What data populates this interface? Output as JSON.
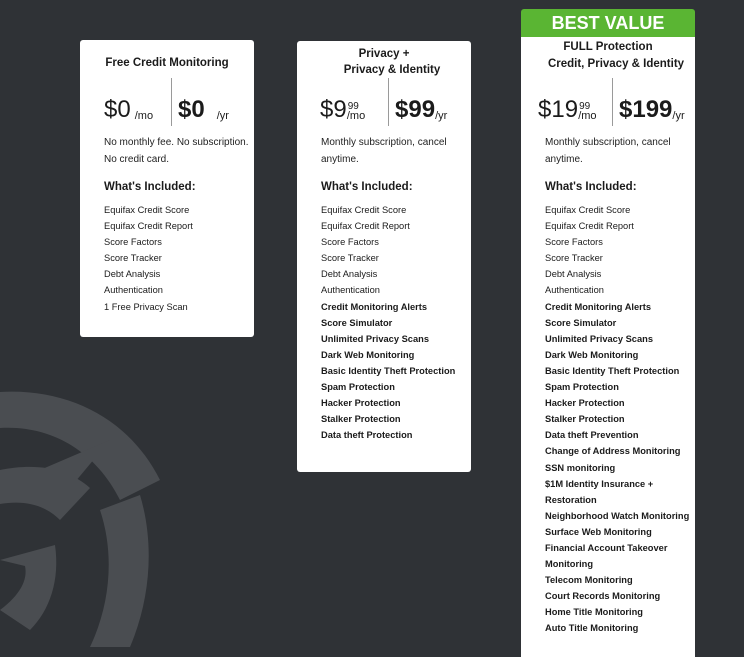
{
  "colors": {
    "background": "#2f3236",
    "card": "#ffffff",
    "badge": "#5ab533"
  },
  "plans": [
    {
      "title_line1": "Free Credit Monitoring",
      "title_line2": "",
      "monthly": {
        "currency": "$",
        "amount": "0",
        "cents": "",
        "unit": "/mo"
      },
      "yearly": {
        "currency": "$",
        "amount": "0",
        "unit": "/yr"
      },
      "description": [
        "No monthly fee. No subscription.",
        "No credit card."
      ],
      "included_heading": "What's Included:",
      "features": [
        {
          "text": "Equifax Credit Score",
          "bold": false
        },
        {
          "text": "Equifax Credit Report",
          "bold": false
        },
        {
          "text": "Score Factors",
          "bold": false
        },
        {
          "text": "Score Tracker",
          "bold": false
        },
        {
          "text": "Debt Analysis",
          "bold": false
        },
        {
          "text": "Authentication",
          "bold": false
        },
        {
          "text": "1 Free Privacy Scan",
          "bold": false
        }
      ]
    },
    {
      "title_line1": "Privacy +",
      "title_line2": "Privacy & Identity",
      "monthly": {
        "currency": "$",
        "amount": "9",
        "cents": "99",
        "unit": "/mo"
      },
      "yearly": {
        "currency": "$",
        "amount": "99",
        "unit": "/yr"
      },
      "description": [
        "Monthly subscription, cancel",
        "anytime."
      ],
      "included_heading": "What's Included:",
      "features": [
        {
          "text": "Equifax Credit Score",
          "bold": false
        },
        {
          "text": "Equifax Credit Report",
          "bold": false
        },
        {
          "text": "Score Factors",
          "bold": false
        },
        {
          "text": "Score Tracker",
          "bold": false
        },
        {
          "text": "Debt Analysis",
          "bold": false
        },
        {
          "text": "Authentication",
          "bold": false
        },
        {
          "text": "Credit Monitoring Alerts",
          "bold": true
        },
        {
          "text": "Score Simulator",
          "bold": true
        },
        {
          "text": "Unlimited Privacy Scans",
          "bold": true
        },
        {
          "text": "Dark Web Monitoring",
          "bold": true
        },
        {
          "text": "Basic Identity Theft Protection",
          "bold": true
        },
        {
          "text": "Spam Protection",
          "bold": true
        },
        {
          "text": "Hacker Protection",
          "bold": true
        },
        {
          "text": "Stalker Protection",
          "bold": true
        },
        {
          "text": "Data theft Protection",
          "bold": true
        }
      ]
    },
    {
      "badge": "BEST VALUE",
      "title_line1": "FULL Protection",
      "title_line2": "Credit, Privacy & Identity",
      "monthly": {
        "currency": "$",
        "amount": "19",
        "cents": "99",
        "unit": "/mo"
      },
      "yearly": {
        "currency": "$",
        "amount": "199",
        "unit": "/yr"
      },
      "description": [
        "Monthly subscription, cancel",
        "anytime."
      ],
      "included_heading": "What's Included:",
      "features": [
        {
          "text": "Equifax Credit Score",
          "bold": false
        },
        {
          "text": "Equifax Credit Report",
          "bold": false
        },
        {
          "text": "Score Factors",
          "bold": false
        },
        {
          "text": "Score Tracker",
          "bold": false
        },
        {
          "text": "Debt Analysis",
          "bold": false
        },
        {
          "text": "Authentication",
          "bold": false
        },
        {
          "text": "Credit Monitoring Alerts",
          "bold": true
        },
        {
          "text": "Score Simulator",
          "bold": true
        },
        {
          "text": "Unlimited Privacy Scans",
          "bold": true
        },
        {
          "text": "Dark Web Monitoring",
          "bold": true
        },
        {
          "text": "Basic Identity Theft Protection",
          "bold": true
        },
        {
          "text": "Spam Protection",
          "bold": true
        },
        {
          "text": "Hacker Protection",
          "bold": true
        },
        {
          "text": "Stalker Protection",
          "bold": true
        },
        {
          "text": "Data theft Prevention",
          "bold": true
        },
        {
          "text": "Change of Address Monitoring",
          "bold": true
        },
        {
          "text": "SSN monitoring",
          "bold": true
        },
        {
          "text": "$1M Identity Insurance +",
          "bold": true
        },
        {
          "text": "Restoration",
          "bold": true
        },
        {
          "text": "Neighborhood Watch Monitoring",
          "bold": true
        },
        {
          "text": "Surface Web Monitoring",
          "bold": true
        },
        {
          "text": "Financial Account Takeover",
          "bold": true
        },
        {
          "text": "Monitoring",
          "bold": true
        },
        {
          "text": "Telecom Monitoring",
          "bold": true
        },
        {
          "text": "Court Records Monitoring",
          "bold": true
        },
        {
          "text": "Home Title Monitoring",
          "bold": true
        },
        {
          "text": "Auto Title Monitoring",
          "bold": true
        }
      ]
    }
  ]
}
